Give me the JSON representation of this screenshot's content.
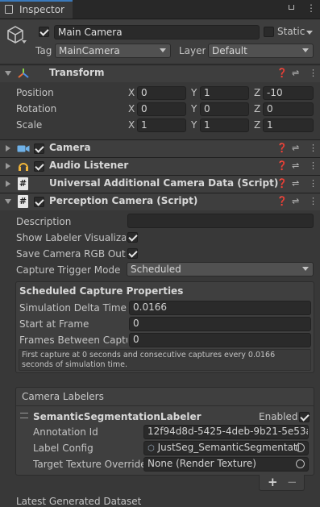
{
  "tab": {
    "title": "Inspector"
  },
  "object": {
    "name": "Main Camera",
    "static_label": "Static",
    "tag_label": "Tag",
    "tag_value": "MainCamera",
    "layer_label": "Layer",
    "layer_value": "Default"
  },
  "transform": {
    "title": "Transform",
    "rows": [
      {
        "label": "Position",
        "x": "0",
        "y": "1",
        "z": "-10"
      },
      {
        "label": "Rotation",
        "x": "0",
        "y": "0",
        "z": "0"
      },
      {
        "label": "Scale",
        "x": "1",
        "y": "1",
        "z": "1"
      }
    ],
    "axes": {
      "x": "X",
      "y": "Y",
      "z": "Z"
    }
  },
  "components": {
    "camera": "Camera",
    "audio": "Audio Listener",
    "uacd": "Universal Additional Camera Data (Script)",
    "perception": "Perception Camera (Script)"
  },
  "perception": {
    "description_label": "Description",
    "description_value": "",
    "show_labeler_label": "Show Labeler Visualizat",
    "save_rgb_label": "Save Camera RGB Outpu",
    "trigger_label": "Capture Trigger Mode",
    "trigger_value": "Scheduled",
    "scheduled_title": "Scheduled Capture Properties",
    "sim_delta_label": "Simulation Delta Time",
    "sim_delta_value": "0.0166",
    "start_frame_label": "Start at Frame",
    "start_frame_value": "0",
    "frames_between_label": "Frames Between Captur",
    "frames_between_value": "0",
    "info_text": "First capture at 0 seconds and consecutive captures every 0.0166 seconds of simulation time."
  },
  "labelers": {
    "title": "Camera Labelers",
    "item_title": "SemanticSegmentationLabeler",
    "enabled_label": "Enabled",
    "annotation_label": "Annotation Id",
    "annotation_value": "12f94d8d-5425-4deb-9b21-5e53a",
    "label_config_label": "Label Config",
    "label_config_value": "JustSeg_SemanticSegmentati",
    "target_label": "Target Texture Override",
    "target_value": "None (Render Texture)",
    "add": "+",
    "remove": "−"
  },
  "footer": {
    "latest_dataset": "Latest Generated Dataset"
  }
}
